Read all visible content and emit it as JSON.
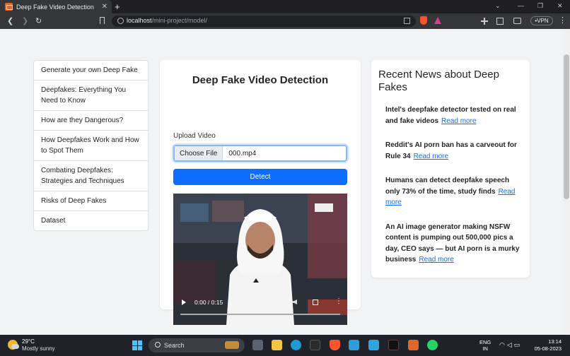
{
  "browser": {
    "tab_title": "Deep Fake Video Detection",
    "tab_close": "✕",
    "new_tab": "+",
    "url_host": "localhost",
    "url_path": "/mini-project/model/",
    "vpn_label": "•VPN",
    "window_controls": [
      "⌄",
      "—",
      "❐",
      "✕"
    ],
    "nav_buttons": [
      "❮",
      "❯",
      "↻"
    ]
  },
  "sidebar": {
    "items": [
      {
        "label": "Generate your own Deep Fake"
      },
      {
        "label": "Deepfakes: Everything You Need to Know"
      },
      {
        "label": "How are they Dangerous?"
      },
      {
        "label": "How Deepfakes Work and How to Spot Them"
      },
      {
        "label": "Combating Deepfakes: Strategies and Techniques"
      },
      {
        "label": "Risks of Deep Fakes"
      },
      {
        "label": "Dataset"
      }
    ]
  },
  "detector": {
    "title": "Deep Fake Video Detection",
    "upload_label": "Upload Video",
    "choose_file_label": "Choose File",
    "file_name": "000.mp4",
    "detect_label": "Detect",
    "video": {
      "time": "0:00 / 0:15",
      "progress": 0
    }
  },
  "news": {
    "title": "Recent News about Deep Fakes",
    "link_label": "Read more",
    "items": [
      {
        "headline": "Intel's deepfake detector tested on real and fake videos"
      },
      {
        "headline": "Reddit's AI porn ban has a carveout for Rule 34"
      },
      {
        "headline": "Humans can detect deepfake speech only 73% of the time, study finds"
      },
      {
        "headline": "An AI image generator making NSFW content is pumping out 500,000 pics a day, CEO says — but AI porn is a murky business"
      }
    ]
  },
  "taskbar": {
    "temperature": "29°C",
    "condition": "Mostly sunny",
    "search_placeholder": "Search",
    "language_line1": "ENG",
    "language_line2": "IN",
    "time": "13:14",
    "date": "05-08-2023"
  },
  "colors": {
    "primary": "#0d6efd",
    "page_bg": "#f2f3f5",
    "taskbar_bg": "#1f2329"
  }
}
